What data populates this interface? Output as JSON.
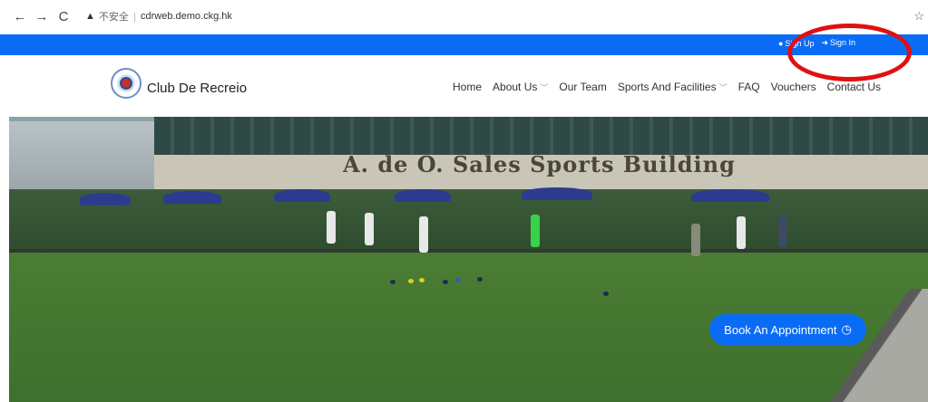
{
  "browser": {
    "back": "←",
    "forward": "→",
    "reload": "C",
    "warning_icon": "▲",
    "insecure_label": "不安全",
    "url": "cdrweb.demo.ckg.hk",
    "star_icon": "☆"
  },
  "topbar": {
    "signup_label": "Sign Up",
    "signin_label": "Sign In"
  },
  "header": {
    "brand": "Club De Recreio",
    "menu": [
      {
        "label": "Home"
      },
      {
        "label": "About Us",
        "chevron": "﹀"
      },
      {
        "label": "Our Team"
      },
      {
        "label": "Sports And Facilities",
        "chevron": "﹀"
      },
      {
        "label": "FAQ"
      },
      {
        "label": "Vouchers"
      },
      {
        "label": "Contact Us"
      }
    ]
  },
  "hero": {
    "sign_text": "A. de O. Sales Sports Building",
    "cta_label": "Book An Appointment",
    "cta_icon": "clock-icon"
  },
  "colors": {
    "primary": "#0a6cf5",
    "annotation": "#e01010"
  }
}
